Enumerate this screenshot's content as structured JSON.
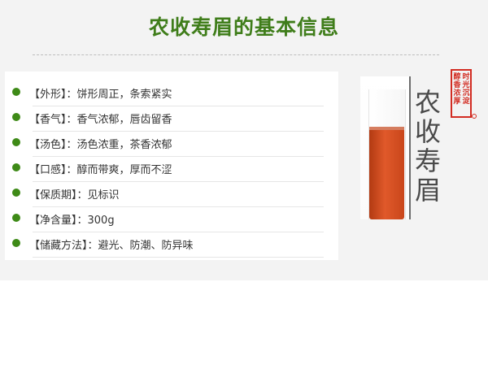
{
  "title": "农收寿眉的基本信息",
  "specs": [
    "【外形】：饼形周正，条索紧实",
    "【香气】：香气浓郁，唇齿留香",
    "【汤色】：汤色浓重，茶香浓郁",
    "【口感】：醇而带爽，厚而不涩",
    "【保质期】：见标识",
    "【净含量】：300g",
    "【储藏方法】：避光、防潮、防异味"
  ],
  "product_name": "农收寿眉",
  "seal": {
    "right_column": "时光沉淀",
    "left_column": "醇香浓厚"
  },
  "colors": {
    "title_green": "#3f7d1a",
    "bullet_green": "#3e8a17",
    "seal_red": "#d22c22",
    "tea_amber": "#d2501f"
  }
}
